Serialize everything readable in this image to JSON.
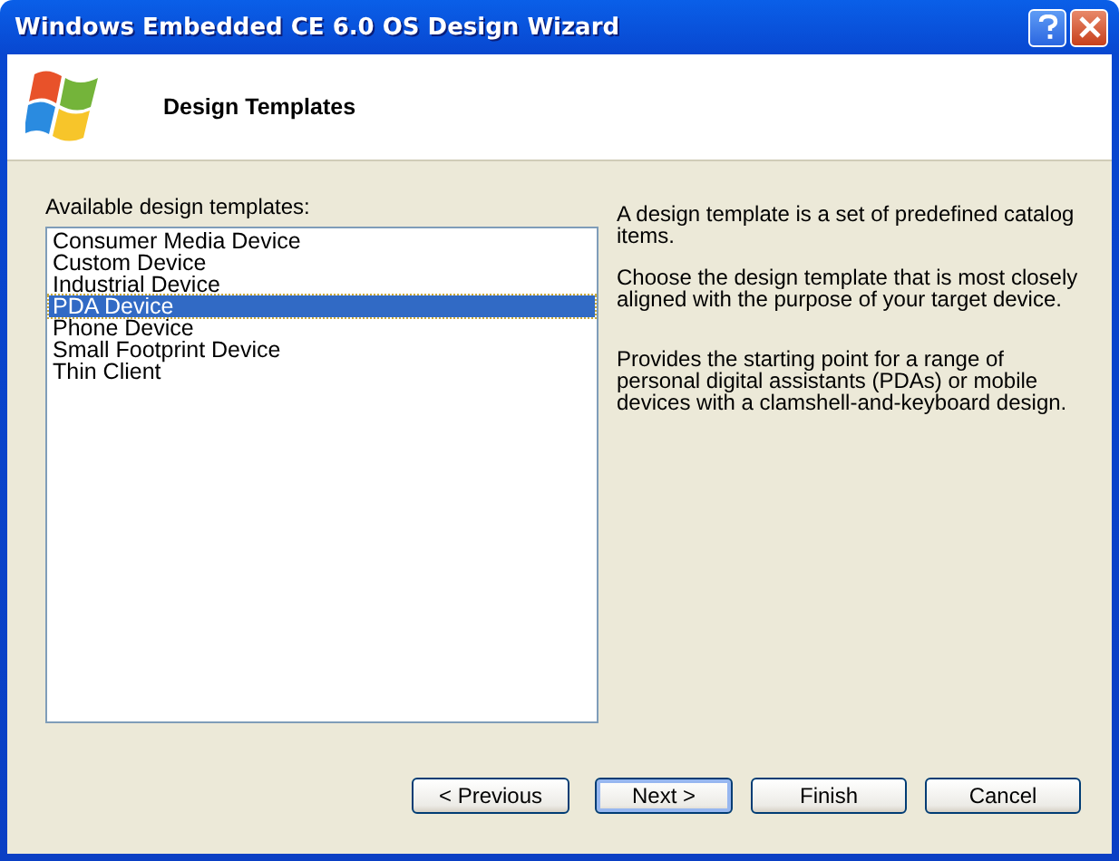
{
  "window": {
    "title": "Windows Embedded CE 6.0 OS Design Wizard"
  },
  "header": {
    "title": "Design Templates"
  },
  "list": {
    "label": "Available design templates:",
    "items": [
      {
        "label": "Consumer Media Device",
        "selected": false
      },
      {
        "label": "Custom Device",
        "selected": false
      },
      {
        "label": "Industrial Device",
        "selected": false
      },
      {
        "label": "PDA Device",
        "selected": true
      },
      {
        "label": "Phone Device",
        "selected": false
      },
      {
        "label": "Small Footprint Device",
        "selected": false
      },
      {
        "label": "Thin Client",
        "selected": false
      }
    ]
  },
  "description": [
    "A design template is a set of predefined catalog items.",
    "Choose the design template that is most closely aligned with the purpose of your target device.",
    "Provides the starting point for a range of personal digital assistants (PDAs) or mobile devices with a clamshell-and-keyboard design."
  ],
  "buttons": [
    {
      "label": "< Previous",
      "default": false
    },
    {
      "label": "Next >",
      "default": true
    },
    {
      "label": "Finish",
      "default": false
    },
    {
      "label": "Cancel",
      "default": false
    }
  ]
}
